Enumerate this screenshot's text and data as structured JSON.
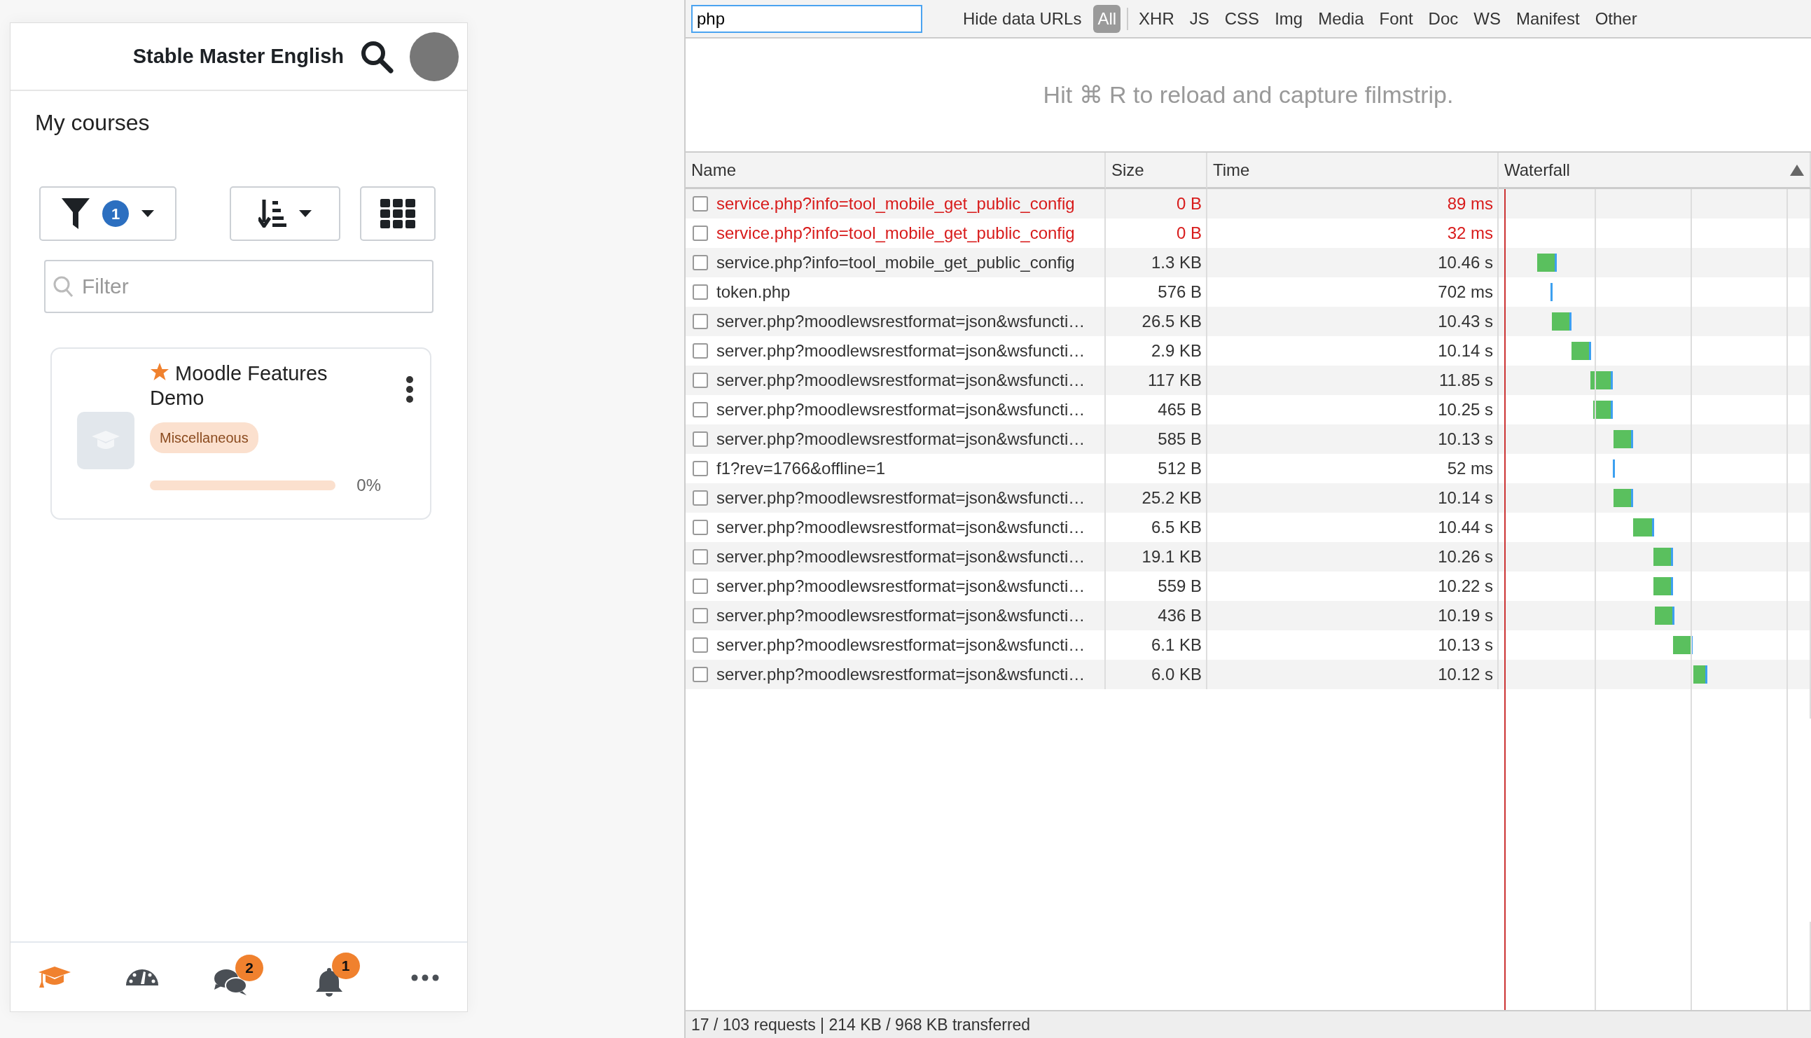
{
  "app": {
    "site_name": "Stable Master English",
    "page_title": "My courses",
    "filter_count": "1",
    "filter_placeholder": "Filter",
    "courses": [
      {
        "name": "Moodle Features Demo",
        "favourite": true,
        "category": "Miscellaneous",
        "level": 0,
        "progress": "0%"
      }
    ],
    "bottom_nav": [
      {
        "kind": "courses",
        "selected": true
      },
      {
        "kind": "dashboard",
        "selected": false
      },
      {
        "kind": "messages",
        "badge": "2",
        "selected": false
      },
      {
        "kind": "notifications",
        "badge": "1",
        "selected": false
      },
      {
        "kind": "more",
        "selected": false
      }
    ]
  },
  "devtools": {
    "filter_value": "php",
    "hide_data_urls": "Hide data URLs",
    "type_filters": [
      {
        "label": "All",
        "selected": true
      },
      {
        "label": "XHR",
        "selected": false
      },
      {
        "label": "JS",
        "selected": false
      },
      {
        "label": "CSS",
        "selected": false
      },
      {
        "label": "Img",
        "selected": false
      },
      {
        "label": "Media",
        "selected": false
      },
      {
        "label": "Font",
        "selected": false
      },
      {
        "label": "Doc",
        "selected": false
      },
      {
        "label": "WS",
        "selected": false
      },
      {
        "label": "Manifest",
        "selected": false
      },
      {
        "label": "Other",
        "selected": false
      }
    ],
    "filmstrip_hint": "Hit ⌘ R to reload and capture filmstrip.",
    "columns": [
      "Name",
      "Size",
      "Time",
      "Waterfall"
    ],
    "rows": [
      {
        "name": "service.php?info=tool_mobile_get_public_config",
        "size": "0 B",
        "time": "89 ms",
        "failed": true,
        "checked": false
      },
      {
        "name": "service.php?info=tool_mobile_get_public_config",
        "size": "0 B",
        "time": "32 ms",
        "failed": true,
        "checked": false
      },
      {
        "name": "service.php?info=tool_mobile_get_public_config",
        "size": "1.3 KB",
        "time": "10.46 s",
        "failed": false,
        "checked": false
      },
      {
        "name": "token.php",
        "size": "576 B",
        "time": "702 ms",
        "failed": false,
        "checked": false
      },
      {
        "name": "server.php?moodlewsrestformat=json&wsfuncti…",
        "size": "26.5 KB",
        "time": "10.43 s",
        "failed": false,
        "checked": false
      },
      {
        "name": "server.php?moodlewsrestformat=json&wsfuncti…",
        "size": "2.9 KB",
        "time": "10.14 s",
        "failed": false,
        "checked": false
      },
      {
        "name": "server.php?moodlewsrestformat=json&wsfuncti…",
        "size": "117 KB",
        "time": "11.85 s",
        "failed": false,
        "checked": false
      },
      {
        "name": "server.php?moodlewsrestformat=json&wsfuncti…",
        "size": "465 B",
        "time": "10.25 s",
        "failed": false,
        "checked": false
      },
      {
        "name": "server.php?moodlewsrestformat=json&wsfuncti…",
        "size": "585 B",
        "time": "10.13 s",
        "failed": false,
        "checked": false
      },
      {
        "name": "f1?rev=1766&offline=1",
        "size": "512 B",
        "time": "52 ms",
        "failed": false,
        "checked": false
      },
      {
        "name": "server.php?moodlewsrestformat=json&wsfuncti…",
        "size": "25.2 KB",
        "time": "10.14 s",
        "failed": false,
        "checked": false
      },
      {
        "name": "server.php?moodlewsrestformat=json&wsfuncti…",
        "size": "6.5 KB",
        "time": "10.44 s",
        "failed": false,
        "checked": false
      },
      {
        "name": "server.php?moodlewsrestformat=json&wsfuncti…",
        "size": "19.1 KB",
        "time": "10.26 s",
        "failed": false,
        "checked": false
      },
      {
        "name": "server.php?moodlewsrestformat=json&wsfuncti…",
        "size": "559 B",
        "time": "10.22 s",
        "failed": false,
        "checked": false
      },
      {
        "name": "server.php?moodlewsrestformat=json&wsfuncti…",
        "size": "436 B",
        "time": "10.19 s",
        "failed": false,
        "checked": false
      },
      {
        "name": "server.php?moodlewsrestformat=json&wsfuncti…",
        "size": "6.1 KB",
        "time": "10.13 s",
        "failed": false,
        "checked": false
      },
      {
        "name": "server.php?moodlewsrestformat=json&wsfuncti…",
        "size": "6.0 KB",
        "time": "10.12 s",
        "failed": false,
        "checked": false
      }
    ],
    "status_bar": "17 / 103 requests | 214 KB / 968 KB transferred"
  }
}
